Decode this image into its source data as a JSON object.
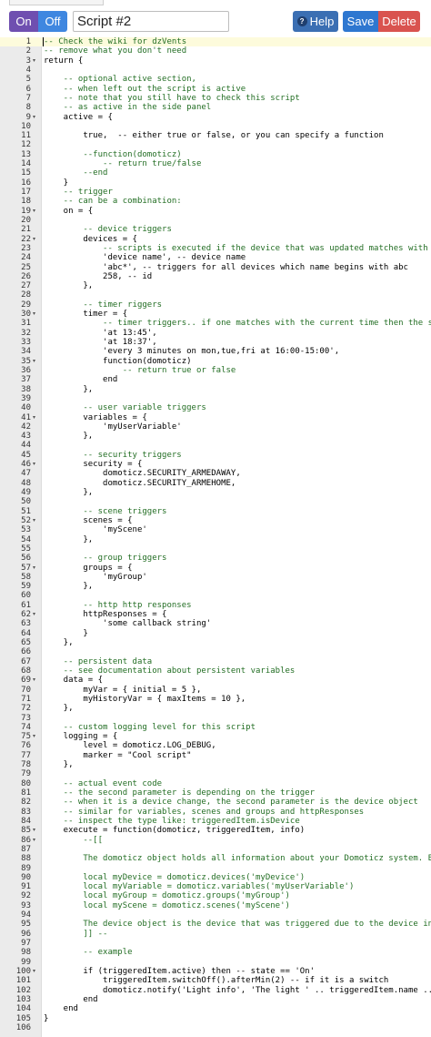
{
  "toolbar": {
    "on_label": "On",
    "off_label": "Off",
    "script_name": "Script #2",
    "help_label": "Help",
    "help_icon_glyph": "?",
    "save_label": "Save",
    "delete_label": "Delete"
  },
  "colors": {
    "on": "#6f4fb0",
    "off": "#3f87e0",
    "help": "#3b6fb3",
    "save": "#2e77d0",
    "delete": "#d9534f",
    "comment": "#236e24",
    "string": "#a31515",
    "keyword": "#0000cc",
    "number": "#0a9a0a"
  },
  "editor": {
    "lines": [
      {
        "n": "1",
        "fold": false,
        "text": "-- Check the wiki for dzVents",
        "kind": "comment"
      },
      {
        "n": "2",
        "fold": false,
        "text": "-- remove what you don't need",
        "kind": "comment"
      },
      {
        "n": "3",
        "fold": true,
        "text": "return {",
        "kind": "code"
      },
      {
        "n": "4",
        "fold": false,
        "text": "",
        "kind": "code"
      },
      {
        "n": "5",
        "fold": false,
        "text": "    -- optional active section,",
        "kind": "comment"
      },
      {
        "n": "6",
        "fold": false,
        "text": "    -- when left out the script is active",
        "kind": "comment"
      },
      {
        "n": "7",
        "fold": false,
        "text": "    -- note that you still have to check this script",
        "kind": "comment"
      },
      {
        "n": "8",
        "fold": false,
        "text": "    -- as active in the side panel",
        "kind": "comment"
      },
      {
        "n": "9",
        "fold": true,
        "text": "    active = {",
        "kind": "code"
      },
      {
        "n": "10",
        "fold": false,
        "text": "",
        "kind": "code"
      },
      {
        "n": "11",
        "fold": false,
        "text": "        true,  -- either true or false, or you can specify a function",
        "kind": "code"
      },
      {
        "n": "12",
        "fold": false,
        "text": "",
        "kind": "code"
      },
      {
        "n": "13",
        "fold": false,
        "text": "        --function(domoticz)",
        "kind": "comment"
      },
      {
        "n": "14",
        "fold": false,
        "text": "            -- return true/false",
        "kind": "comment"
      },
      {
        "n": "15",
        "fold": false,
        "text": "        --end",
        "kind": "comment"
      },
      {
        "n": "16",
        "fold": false,
        "text": "    }",
        "kind": "code"
      },
      {
        "n": "17",
        "fold": false,
        "text": "    -- trigger",
        "kind": "comment"
      },
      {
        "n": "18",
        "fold": false,
        "text": "    -- can be a combination:",
        "kind": "comment"
      },
      {
        "n": "19",
        "fold": true,
        "text": "    on = {",
        "kind": "code"
      },
      {
        "n": "20",
        "fold": false,
        "text": "",
        "kind": "code"
      },
      {
        "n": "21",
        "fold": false,
        "text": "        -- device triggers",
        "kind": "comment"
      },
      {
        "n": "22",
        "fold": true,
        "text": "        devices = {",
        "kind": "code"
      },
      {
        "n": "23",
        "fold": false,
        "text": "            -- scripts is executed if the device that was updated matches with one of these triggers",
        "kind": "comment"
      },
      {
        "n": "24",
        "fold": false,
        "text": "            'device name', -- device name",
        "kind": "code"
      },
      {
        "n": "25",
        "fold": false,
        "text": "            'abc*', -- triggers for all devices which name begins with abc",
        "kind": "code"
      },
      {
        "n": "26",
        "fold": false,
        "text": "            258, -- id",
        "kind": "code"
      },
      {
        "n": "27",
        "fold": false,
        "text": "        },",
        "kind": "code"
      },
      {
        "n": "28",
        "fold": false,
        "text": "",
        "kind": "code"
      },
      {
        "n": "29",
        "fold": false,
        "text": "        -- timer riggers",
        "kind": "comment"
      },
      {
        "n": "30",
        "fold": true,
        "text": "        timer = {",
        "kind": "code"
      },
      {
        "n": "31",
        "fold": false,
        "text": "            -- timer triggers.. if one matches with the current time then the script is executed",
        "kind": "comment"
      },
      {
        "n": "32",
        "fold": false,
        "text": "            'at 13:45',",
        "kind": "code"
      },
      {
        "n": "33",
        "fold": false,
        "text": "            'at 18:37',",
        "kind": "code"
      },
      {
        "n": "34",
        "fold": false,
        "text": "            'every 3 minutes on mon,tue,fri at 16:00-15:00',",
        "kind": "code"
      },
      {
        "n": "35",
        "fold": true,
        "text": "            function(domoticz)",
        "kind": "code"
      },
      {
        "n": "36",
        "fold": false,
        "text": "                -- return true or false",
        "kind": "comment"
      },
      {
        "n": "37",
        "fold": false,
        "text": "            end",
        "kind": "code"
      },
      {
        "n": "38",
        "fold": false,
        "text": "        },",
        "kind": "code"
      },
      {
        "n": "39",
        "fold": false,
        "text": "",
        "kind": "code"
      },
      {
        "n": "40",
        "fold": false,
        "text": "        -- user variable triggers",
        "kind": "comment"
      },
      {
        "n": "41",
        "fold": true,
        "text": "        variables = {",
        "kind": "code"
      },
      {
        "n": "42",
        "fold": false,
        "text": "            'myUserVariable'",
        "kind": "code"
      },
      {
        "n": "43",
        "fold": false,
        "text": "        },",
        "kind": "code"
      },
      {
        "n": "44",
        "fold": false,
        "text": "",
        "kind": "code"
      },
      {
        "n": "45",
        "fold": false,
        "text": "        -- security triggers",
        "kind": "comment"
      },
      {
        "n": "46",
        "fold": true,
        "text": "        security = {",
        "kind": "code"
      },
      {
        "n": "47",
        "fold": false,
        "text": "            domoticz.SECURITY_ARMEDAWAY,",
        "kind": "code"
      },
      {
        "n": "48",
        "fold": false,
        "text": "            domoticz.SECURITY_ARMEHOME,",
        "kind": "code"
      },
      {
        "n": "49",
        "fold": false,
        "text": "        },",
        "kind": "code"
      },
      {
        "n": "50",
        "fold": false,
        "text": "",
        "kind": "code"
      },
      {
        "n": "51",
        "fold": false,
        "text": "        -- scene triggers",
        "kind": "comment"
      },
      {
        "n": "52",
        "fold": true,
        "text": "        scenes = {",
        "kind": "code"
      },
      {
        "n": "53",
        "fold": false,
        "text": "            'myScene'",
        "kind": "code"
      },
      {
        "n": "54",
        "fold": false,
        "text": "        },",
        "kind": "code"
      },
      {
        "n": "55",
        "fold": false,
        "text": "",
        "kind": "code"
      },
      {
        "n": "56",
        "fold": false,
        "text": "        -- group triggers",
        "kind": "comment"
      },
      {
        "n": "57",
        "fold": true,
        "text": "        groups = {",
        "kind": "code"
      },
      {
        "n": "58",
        "fold": false,
        "text": "            'myGroup'",
        "kind": "code"
      },
      {
        "n": "59",
        "fold": false,
        "text": "        },",
        "kind": "code"
      },
      {
        "n": "60",
        "fold": false,
        "text": "",
        "kind": "code"
      },
      {
        "n": "61",
        "fold": false,
        "text": "        -- http http responses",
        "kind": "comment"
      },
      {
        "n": "62",
        "fold": true,
        "text": "        httpResponses = {",
        "kind": "code"
      },
      {
        "n": "63",
        "fold": false,
        "text": "            'some callback string'",
        "kind": "code"
      },
      {
        "n": "64",
        "fold": false,
        "text": "        }",
        "kind": "code"
      },
      {
        "n": "65",
        "fold": false,
        "text": "    },",
        "kind": "code"
      },
      {
        "n": "66",
        "fold": false,
        "text": "",
        "kind": "code"
      },
      {
        "n": "67",
        "fold": false,
        "text": "    -- persistent data",
        "kind": "comment"
      },
      {
        "n": "68",
        "fold": false,
        "text": "    -- see documentation about persistent variables",
        "kind": "comment"
      },
      {
        "n": "69",
        "fold": true,
        "text": "    data = {",
        "kind": "code"
      },
      {
        "n": "70",
        "fold": false,
        "text": "        myVar = { initial = 5 },",
        "kind": "code"
      },
      {
        "n": "71",
        "fold": false,
        "text": "        myHistoryVar = { maxItems = 10 },",
        "kind": "code"
      },
      {
        "n": "72",
        "fold": false,
        "text": "    },",
        "kind": "code"
      },
      {
        "n": "73",
        "fold": false,
        "text": "",
        "kind": "code"
      },
      {
        "n": "74",
        "fold": false,
        "text": "    -- custom logging level for this script",
        "kind": "comment"
      },
      {
        "n": "75",
        "fold": true,
        "text": "    logging = {",
        "kind": "code"
      },
      {
        "n": "76",
        "fold": false,
        "text": "        level = domoticz.LOG_DEBUG,",
        "kind": "code"
      },
      {
        "n": "77",
        "fold": false,
        "text": "        marker = \"Cool script\"",
        "kind": "code"
      },
      {
        "n": "78",
        "fold": false,
        "text": "    },",
        "kind": "code"
      },
      {
        "n": "79",
        "fold": false,
        "text": "",
        "kind": "code"
      },
      {
        "n": "80",
        "fold": false,
        "text": "    -- actual event code",
        "kind": "comment"
      },
      {
        "n": "81",
        "fold": false,
        "text": "    -- the second parameter is depending on the trigger",
        "kind": "comment"
      },
      {
        "n": "82",
        "fold": false,
        "text": "    -- when it is a device change, the second parameter is the device object",
        "kind": "comment"
      },
      {
        "n": "83",
        "fold": false,
        "text": "    -- similar for variables, scenes and groups and httpResponses",
        "kind": "comment"
      },
      {
        "n": "84",
        "fold": false,
        "text": "    -- inspect the type like: triggeredItem.isDevice",
        "kind": "comment"
      },
      {
        "n": "85",
        "fold": true,
        "text": "    execute = function(domoticz, triggeredItem, info)",
        "kind": "code"
      },
      {
        "n": "86",
        "fold": true,
        "text": "        --[[",
        "kind": "comment"
      },
      {
        "n": "87",
        "fold": false,
        "text": "",
        "kind": "comment"
      },
      {
        "n": "88",
        "fold": false,
        "text": "        The domoticz object holds all information about your Domoticz system. E.g.:",
        "kind": "comment"
      },
      {
        "n": "89",
        "fold": false,
        "text": "",
        "kind": "comment"
      },
      {
        "n": "90",
        "fold": false,
        "text": "        local myDevice = domoticz.devices('myDevice')",
        "kind": "comment"
      },
      {
        "n": "91",
        "fold": false,
        "text": "        local myVariable = domoticz.variables('myUserVariable')",
        "kind": "comment"
      },
      {
        "n": "92",
        "fold": false,
        "text": "        local myGroup = domoticz.groups('myGroup')",
        "kind": "comment"
      },
      {
        "n": "93",
        "fold": false,
        "text": "        local myScene = domoticz.scenes('myScene')",
        "kind": "comment"
      },
      {
        "n": "94",
        "fold": false,
        "text": "",
        "kind": "comment"
      },
      {
        "n": "95",
        "fold": false,
        "text": "        The device object is the device that was triggered due to the device in the 'on' section",
        "kind": "comment"
      },
      {
        "n": "96",
        "fold": false,
        "text": "        ]] --",
        "kind": "comment"
      },
      {
        "n": "97",
        "fold": false,
        "text": "",
        "kind": "code"
      },
      {
        "n": "98",
        "fold": false,
        "text": "        -- example",
        "kind": "comment"
      },
      {
        "n": "99",
        "fold": false,
        "text": "",
        "kind": "code"
      },
      {
        "n": "100",
        "fold": true,
        "text": "        if (triggeredItem.active) then -- state == 'On'",
        "kind": "code"
      },
      {
        "n": "101",
        "fold": false,
        "text": "            triggeredItem.switchOff().afterMin(2) -- if it is a switch",
        "kind": "code"
      },
      {
        "n": "102",
        "fold": false,
        "text": "            domoticz.notify('Light info', 'The light ' .. triggeredItem.name .. ' will be switched off soon')",
        "kind": "code"
      },
      {
        "n": "103",
        "fold": false,
        "text": "        end",
        "kind": "code"
      },
      {
        "n": "104",
        "fold": false,
        "text": "    end",
        "kind": "code"
      },
      {
        "n": "105",
        "fold": false,
        "text": "}",
        "kind": "code"
      },
      {
        "n": "106",
        "fold": false,
        "text": "",
        "kind": "code"
      }
    ]
  }
}
